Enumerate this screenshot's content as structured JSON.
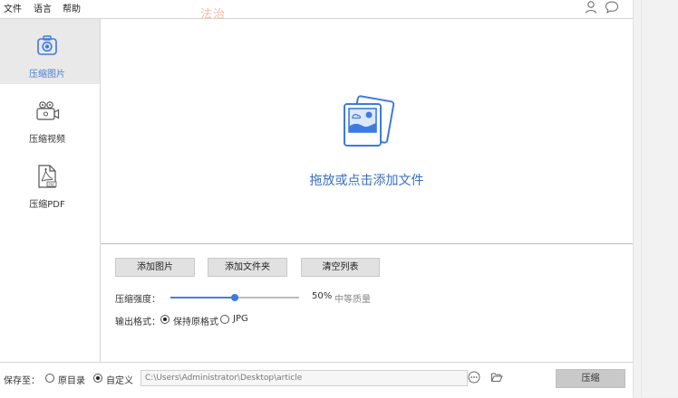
{
  "menubar": {
    "items": [
      "文件",
      "语言",
      "帮助"
    ],
    "watermark": "法治"
  },
  "sidebar": {
    "items": [
      {
        "label": "压缩图片",
        "icon": "camera-icon",
        "active": true
      },
      {
        "label": "压缩视频",
        "icon": "video-camera-icon",
        "active": false
      },
      {
        "label": "压缩PDF",
        "icon": "pdf-file-icon",
        "active": false
      }
    ]
  },
  "drop_area": {
    "icon": "image-stack-icon",
    "text": "拖放或点击添加文件"
  },
  "controls": {
    "add_image_label": "添加图片",
    "add_folder_label": "添加文件夹",
    "clear_list_label": "清空列表",
    "strength_label": "压缩强度：",
    "strength_value": 50,
    "strength_text": "50%",
    "quality_text": "中等质量",
    "format_label": "输出格式：",
    "format_options": [
      "保持原格式",
      "JPG"
    ],
    "format_selected": "保持原格式"
  },
  "bottombar": {
    "save_to_label": "保存至：",
    "save_options": [
      "原目录",
      "自定义"
    ],
    "save_selected": "自定义",
    "path_value": "C:\\Users\\Administrator\\Desktop\\article",
    "compress_label": "压缩"
  },
  "colors": {
    "accent": "#4a7fd0",
    "drop_text": "#3a6fbd",
    "watermark": "#f1b8a8"
  }
}
